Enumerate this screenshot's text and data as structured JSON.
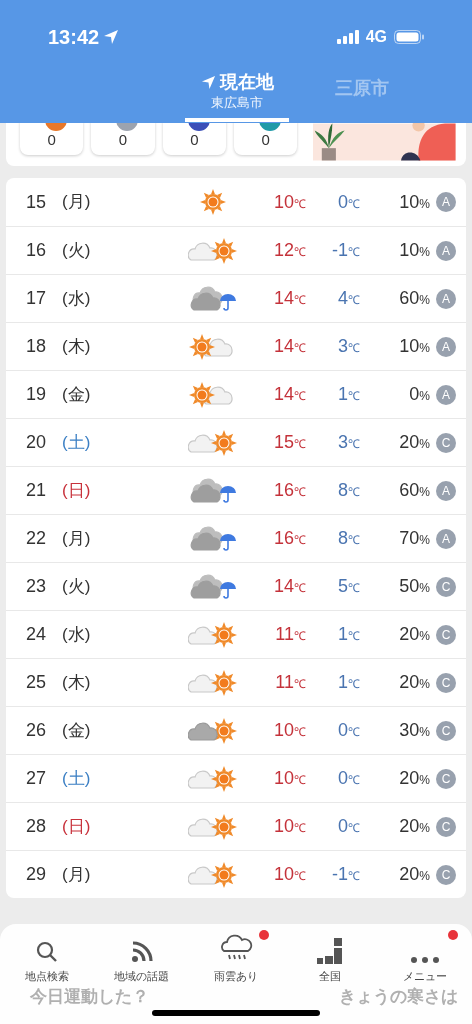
{
  "status_bar": {
    "time": "13:42",
    "network": "4G"
  },
  "tabs": [
    {
      "label": "現在地",
      "sublabel": "東広島市",
      "selected": true
    },
    {
      "label": "三原市",
      "selected": false
    }
  ],
  "counters": [
    {
      "value": "0",
      "color": "#e8782a"
    },
    {
      "value": "0",
      "color": "#9ca3af"
    },
    {
      "value": "0",
      "color": "#3b4fb8"
    },
    {
      "value": "0",
      "color": "#1f9aa8"
    }
  ],
  "forecast": [
    {
      "date": "15",
      "weekday": "(月)",
      "color": "#333333",
      "kind": "sun",
      "high": "10",
      "low": "0",
      "unit": "℃",
      "pop": "10",
      "pct": "%",
      "rank": "A"
    },
    {
      "date": "16",
      "weekday": "(火)",
      "color": "#333333",
      "kind": "cloudsun",
      "high": "12",
      "low": "-1",
      "unit": "℃",
      "pop": "10",
      "pct": "%",
      "rank": "A"
    },
    {
      "date": "17",
      "weekday": "(水)",
      "color": "#333333",
      "kind": "rain",
      "high": "14",
      "low": "4",
      "unit": "℃",
      "pop": "60",
      "pct": "%",
      "rank": "A"
    },
    {
      "date": "18",
      "weekday": "(木)",
      "color": "#333333",
      "kind": "suncloud",
      "high": "14",
      "low": "3",
      "unit": "℃",
      "pop": "10",
      "pct": "%",
      "rank": "A"
    },
    {
      "date": "19",
      "weekday": "(金)",
      "color": "#333333",
      "kind": "suncloud",
      "high": "14",
      "low": "1",
      "unit": "℃",
      "pop": "0",
      "pct": "%",
      "rank": "A"
    },
    {
      "date": "20",
      "weekday": "(土)",
      "color": "#3b7fc4",
      "kind": "cloudsun",
      "high": "15",
      "low": "3",
      "unit": "℃",
      "pop": "20",
      "pct": "%",
      "rank": "C"
    },
    {
      "date": "21",
      "weekday": "(日)",
      "color": "#c8323c",
      "kind": "rain",
      "high": "16",
      "low": "8",
      "unit": "℃",
      "pop": "60",
      "pct": "%",
      "rank": "A"
    },
    {
      "date": "22",
      "weekday": "(月)",
      "color": "#333333",
      "kind": "rain",
      "high": "16",
      "low": "8",
      "unit": "℃",
      "pop": "70",
      "pct": "%",
      "rank": "A"
    },
    {
      "date": "23",
      "weekday": "(火)",
      "color": "#333333",
      "kind": "rain",
      "high": "14",
      "low": "5",
      "unit": "℃",
      "pop": "50",
      "pct": "%",
      "rank": "C"
    },
    {
      "date": "24",
      "weekday": "(水)",
      "color": "#333333",
      "kind": "cloudsun",
      "high": "11",
      "low": "1",
      "unit": "℃",
      "pop": "20",
      "pct": "%",
      "rank": "C"
    },
    {
      "date": "25",
      "weekday": "(木)",
      "color": "#333333",
      "kind": "cloudsun",
      "high": "11",
      "low": "1",
      "unit": "℃",
      "pop": "20",
      "pct": "%",
      "rank": "C"
    },
    {
      "date": "26",
      "weekday": "(金)",
      "color": "#333333",
      "kind": "darkcloudsun",
      "high": "10",
      "low": "0",
      "unit": "℃",
      "pop": "30",
      "pct": "%",
      "rank": "C"
    },
    {
      "date": "27",
      "weekday": "(土)",
      "color": "#3b7fc4",
      "kind": "cloudsun",
      "high": "10",
      "low": "0",
      "unit": "℃",
      "pop": "20",
      "pct": "%",
      "rank": "C"
    },
    {
      "date": "28",
      "weekday": "(日)",
      "color": "#c8323c",
      "kind": "cloudsun",
      "high": "10",
      "low": "0",
      "unit": "℃",
      "pop": "20",
      "pct": "%",
      "rank": "C"
    },
    {
      "date": "29",
      "weekday": "(月)",
      "color": "#333333",
      "kind": "cloudsun",
      "high": "10",
      "low": "-1",
      "unit": "℃",
      "pop": "20",
      "pct": "%",
      "rank": "C"
    }
  ],
  "behind_nav": [
    "今日運動した？",
    "きょうの寒さは"
  ],
  "nav": [
    {
      "label": "地点検索",
      "badge": false
    },
    {
      "label": "地域の話題",
      "badge": false
    },
    {
      "label": "雨雲あり",
      "badge": true
    },
    {
      "label": "全国",
      "badge": false
    },
    {
      "label": "メニュー",
      "badge": true
    }
  ]
}
